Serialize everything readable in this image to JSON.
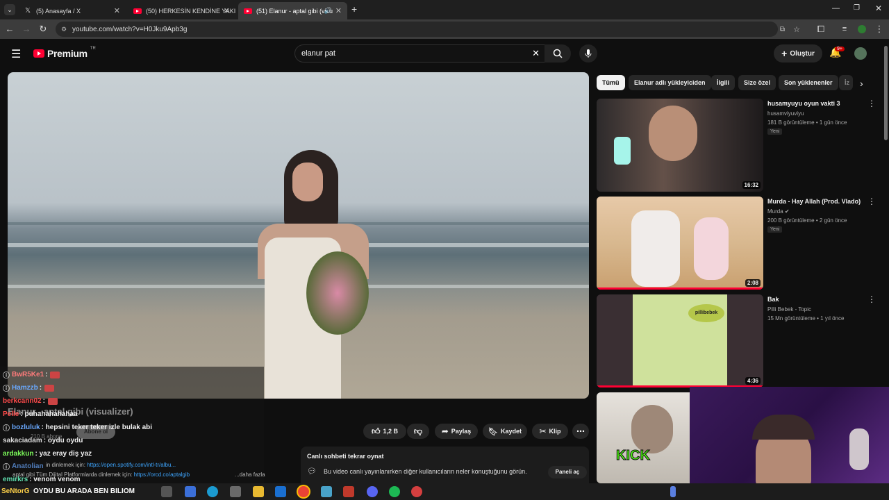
{
  "browser": {
    "tabs": [
      {
        "label": "(5) Anasayfa / X"
      },
      {
        "label": "(50) HERKESİN KENDİNE YAKIŞ"
      },
      {
        "label": "(51) Elanur - aptal gibi (visu"
      }
    ],
    "url": "youtube.com/watch?v=H0Jku9Apb3g"
  },
  "youtube": {
    "logo": "Premium",
    "region": "TR",
    "search_value": "elanur pat",
    "create_label": "Oluştur",
    "notif_count": "9+"
  },
  "chips": [
    "Tümü",
    "Elanur adlı yükleyiciden",
    "İlgili",
    "Size özel",
    "Son yüklenenler",
    "İz"
  ],
  "recommendations": [
    {
      "title": "husamyuyu oyun vakti 3",
      "channel": "husamviyuviyu",
      "meta": "181 B görüntüleme • 1 gün önce",
      "badge": "Yeni",
      "duration": "16:32"
    },
    {
      "title": "Murda - Hay Allah (Prod. Vlado)",
      "channel": "Murda",
      "meta": "200 B görüntüleme • 2 gün önce",
      "badge": "Yeni",
      "duration": "2:08"
    },
    {
      "title": "Bak",
      "channel": "Pilli Bebek - Topic",
      "meta": "15 Mn görüntüleme • 1 yıl önce",
      "badge": "",
      "duration": "4:36"
    },
    {
      "title": "",
      "channel": "",
      "meta": "",
      "badge": "",
      "duration": ""
    }
  ],
  "thumb_text": {
    "pillibebek": "pillibebek",
    "kick": "KICK"
  },
  "video": {
    "title": "Elanur - aptal gibi (visualizer)",
    "subs": "210 B abone",
    "subscribe_label": "Abone ol",
    "likes": "1,2 B",
    "share": "Paylaş",
    "save": "Kaydet",
    "clip": "Klip",
    "desc_line1": "in dinlemek için:",
    "desc_link1": "https://open.spotify.com/intl-tr/albu...",
    "desc_line2": "aptal gibi Tüm Dijital Platformlarda dinlemek için:",
    "desc_link2": "https://orcd.co/aptalgib",
    "desc_more": "...daha fazla"
  },
  "replay": {
    "title": "Canlı sohbeti tekrar oynat",
    "desc": "Bu video canlı yayınlanırken diğer kullanıcıların neler konuştuğunu görün.",
    "button": "Paneli aç"
  },
  "chat": [
    {
      "user": "BwR5Ke1",
      "msg": ""
    },
    {
      "user": "Hamzzb",
      "msg": ""
    },
    {
      "user": "berkcann02",
      "msg": ""
    },
    {
      "user": "Pelle",
      "msg": "puhahahahahaa"
    },
    {
      "user": "bozluluk",
      "msg": "hepsini teker teker izle bulak abi"
    },
    {
      "user": "sakaciadam",
      "msg": "oydu oydu"
    },
    {
      "user": "ardakkun",
      "msg": "yaz eray diş yaz"
    },
    {
      "user": "Anatolian",
      "msg": ""
    },
    {
      "user": "emirkrs",
      "msg": "venom venom"
    },
    {
      "user": "SeNtorG",
      "msg": "OYDU BU ARADA BEN BILIOM"
    }
  ],
  "colors": {
    "accent": "#ff0033",
    "chip_selected": "#f1f1f1",
    "bg": "#0f0f0f"
  }
}
